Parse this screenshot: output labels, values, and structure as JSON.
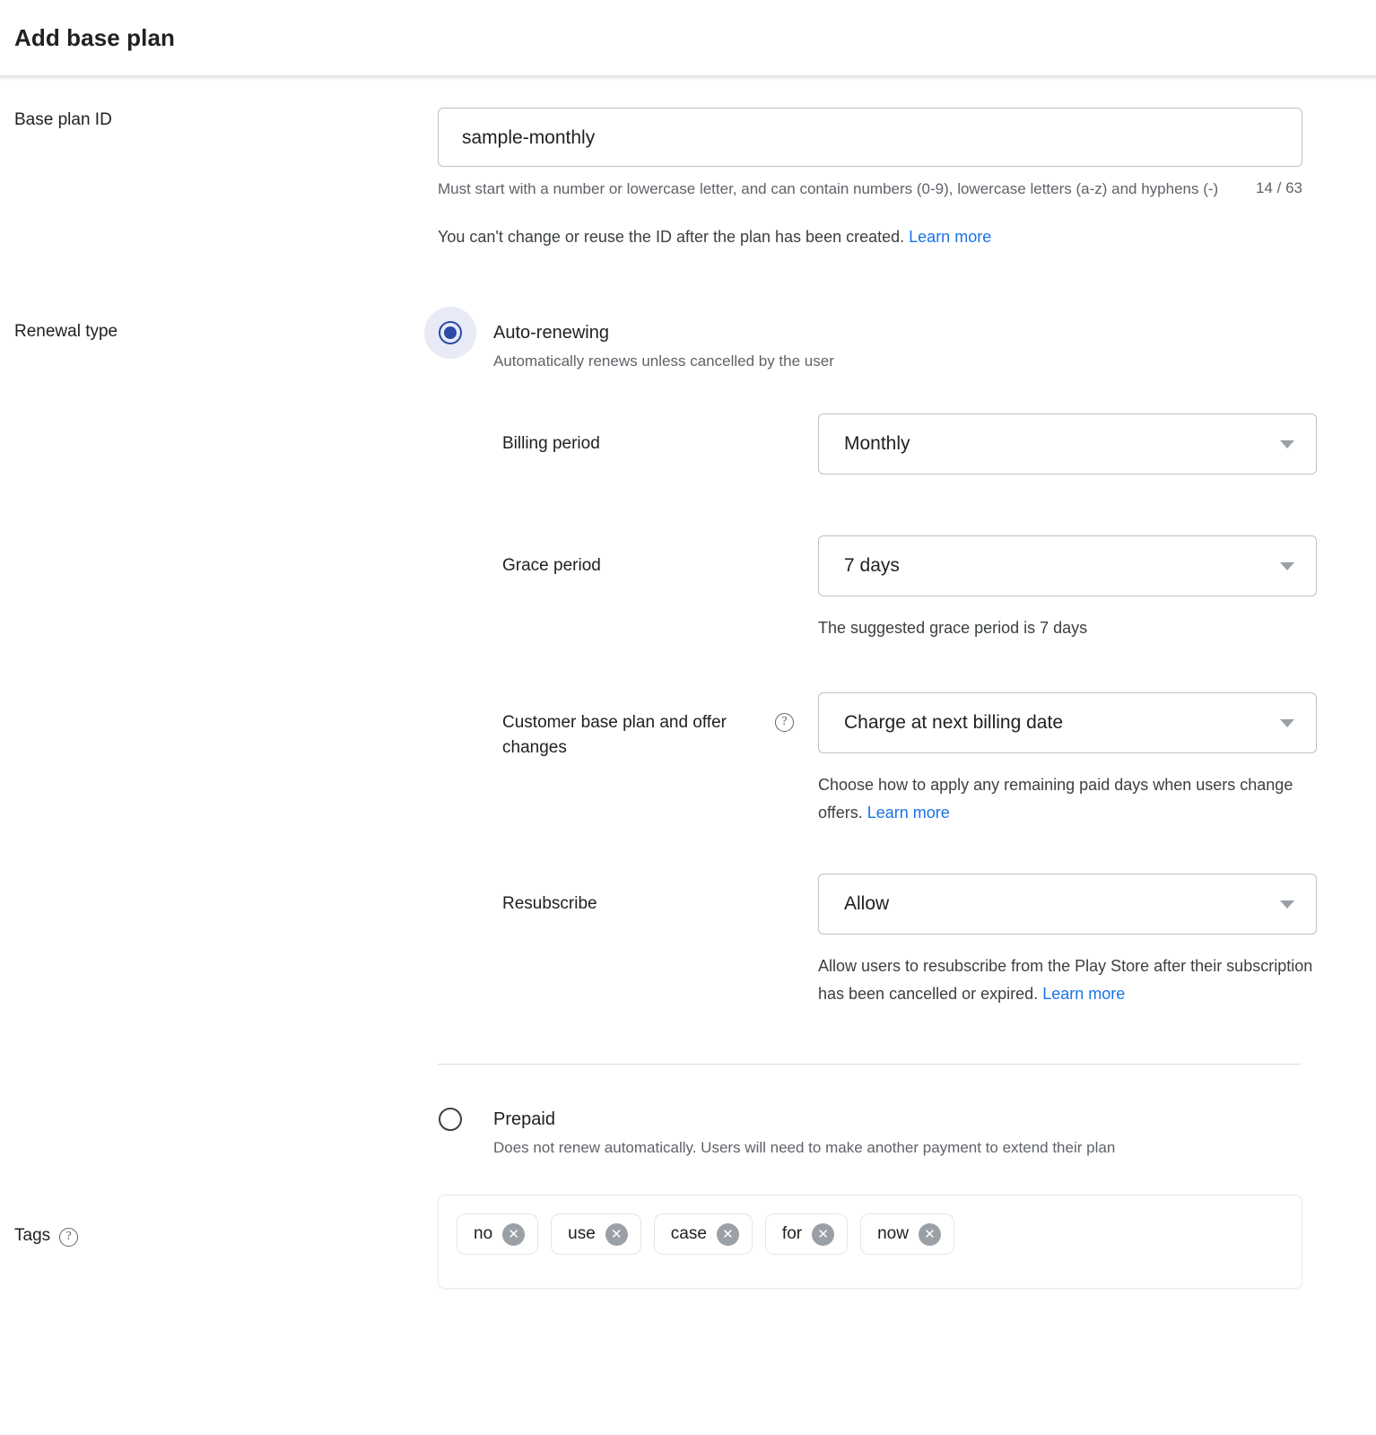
{
  "header": {
    "title": "Add base plan"
  },
  "base_plan": {
    "label": "Base plan ID",
    "value": "sample-monthly",
    "placeholder": "",
    "helper": "Must start with a number or lowercase letter, and can contain numbers (0-9), lowercase letters (a-z) and hyphens (-)",
    "counter": "14 / 63",
    "note_text": "You can't change or reuse the ID after the plan has been created.",
    "note_link": "Learn more"
  },
  "renewal": {
    "label": "Renewal type",
    "auto": {
      "title": "Auto-renewing",
      "subtitle": "Automatically renews unless cancelled by the user",
      "selected": true
    },
    "prepaid": {
      "title": "Prepaid",
      "subtitle": "Does not renew automatically. Users will need to make another payment to extend their plan",
      "selected": false
    },
    "fields": {
      "billing_period": {
        "label": "Billing period",
        "value": "Monthly",
        "options": [
          "Monthly"
        ]
      },
      "grace_period": {
        "label": "Grace period",
        "value": "7 days",
        "options": [
          "7 days"
        ],
        "help": "The suggested grace period is 7 days"
      },
      "offer_changes": {
        "label": "Customer base plan and offer changes",
        "value": "Charge at next billing date",
        "options": [
          "Charge at next billing date"
        ],
        "help_text": "Choose how to apply any remaining paid days when users change offers.",
        "help_link": "Learn more",
        "help_icon": "help-circle-icon"
      },
      "resubscribe": {
        "label": "Resubscribe",
        "value": "Allow",
        "options": [
          "Allow"
        ],
        "help_text": "Allow users to resubscribe from the Play Store after their subscription has been cancelled or expired.",
        "help_link": "Learn more"
      }
    }
  },
  "tags": {
    "label": "Tags",
    "help_icon": "help-circle-icon",
    "items": [
      {
        "text": "no",
        "remove": "✕"
      },
      {
        "text": "use",
        "remove": "✕"
      },
      {
        "text": "case",
        "remove": "✕"
      },
      {
        "text": "for",
        "remove": "✕"
      },
      {
        "text": "now",
        "remove": "✕"
      }
    ]
  },
  "colors": {
    "accent_blue": "#1a73e8",
    "radio_selected": "#2c4ba8",
    "radio_ripple": "#e8eaf6",
    "text_primary": "#202124",
    "text_secondary": "#5f6368",
    "border": "#bdc1c6",
    "chip_x_bg": "#9aa0a6"
  }
}
